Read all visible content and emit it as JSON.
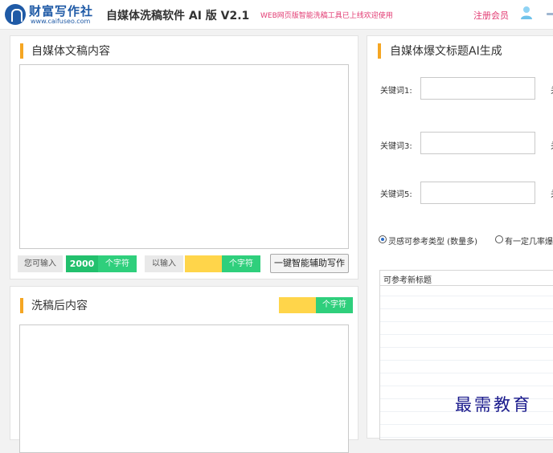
{
  "header": {
    "logo_name": "财富写作社",
    "logo_url": "www.caifuseo.com",
    "app_title": "自媒体洗稿软件 AI 版 V2.1",
    "notice": "WEB网页版智能洗稿工具已上线欢迎使用",
    "register": "注册会员",
    "icons": {
      "logo": "logo-icon",
      "user": "user-icon",
      "menu": "menu-icon"
    },
    "accent_color": "#e23a72"
  },
  "left_panel": {
    "title": "自媒体文稿内容",
    "textarea_value": "",
    "stats": {
      "can_input_label": "您可输入",
      "can_input_value": "2000",
      "can_input_unit": "个字符",
      "entered_label": "以输入",
      "entered_value": "",
      "entered_unit": "个字符"
    },
    "assist_button": "一键智能辅助写作"
  },
  "bottom_panel": {
    "title": "洗稿后内容",
    "count_value": "",
    "count_unit": "个字符",
    "textarea_value": ""
  },
  "right_panel": {
    "title": "自媒体爆文标题AI生成",
    "keywords": [
      {
        "label": "关键词1:",
        "value": ""
      },
      {
        "label": "关",
        "value": ""
      },
      {
        "label": "关键词3:",
        "value": ""
      },
      {
        "label": "关",
        "value": ""
      },
      {
        "label": "关键词5:",
        "value": ""
      },
      {
        "label": "关",
        "value": ""
      }
    ],
    "radio_options": [
      {
        "label": "灵感可参考类型 (数量多)",
        "selected": true
      },
      {
        "label": "有一定几率爆",
        "selected": false
      }
    ],
    "results_header": "可参考新标题"
  },
  "watermark": "最需教育",
  "colors": {
    "title_bar": "#f5a623",
    "green": "#2fcf7c",
    "yellow": "#ffd54a",
    "brand_blue": "#1f5aa6"
  }
}
